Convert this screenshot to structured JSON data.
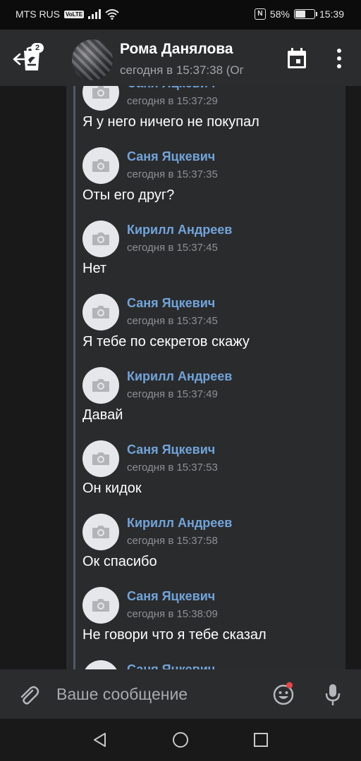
{
  "status_bar": {
    "carrier": "MTS RUS",
    "volte": "VoLTE",
    "nfc": "N",
    "battery_percent": "58%",
    "battery_level": 0.58,
    "time": "15:39"
  },
  "header": {
    "badge_count": "2",
    "title": "Рома Данялова",
    "subtitle": "сегодня в 15:37:38 (Ог"
  },
  "messages": [
    {
      "author": "Саня Яцкевич",
      "time": "сегодня в 15:37:29",
      "text": "Я у него ничего не покупал"
    },
    {
      "author": "Саня Яцкевич",
      "time": "сегодня в 15:37:35",
      "text": "Оты его друг?"
    },
    {
      "author": "Кирилл Андреев",
      "time": "сегодня в 15:37:45",
      "text": "Нет"
    },
    {
      "author": "Саня Яцкевич",
      "time": "сегодня в 15:37:45",
      "text": "Я тебе по секретов скажу"
    },
    {
      "author": "Кирилл Андреев",
      "time": "сегодня в 15:37:49",
      "text": "Давай"
    },
    {
      "author": "Саня Яцкевич",
      "time": "сегодня в 15:37:53",
      "text": "Он кидок"
    },
    {
      "author": "Кирилл Андреев",
      "time": "сегодня в 15:37:58",
      "text": "Ок спасибо"
    },
    {
      "author": "Саня Яцкевич",
      "time": "сегодня в 15:38:09",
      "text": "Не говори что я тебе сказал"
    },
    {
      "author": "Саня Яцкевич",
      "time": "",
      "text": ""
    }
  ],
  "composer": {
    "placeholder": "Ваше сообщение"
  },
  "colors": {
    "header_bg": "#2b2c2e",
    "chat_bg": "#19191a",
    "forwarded_bg": "#2a2b2d",
    "author_name": "#71a4d9",
    "timestamp": "#8f9094",
    "notification_dot": "#e64646"
  },
  "icons": {
    "back": "back-arrow-icon",
    "calendar": "calendar-icon",
    "more": "more-vertical-icon",
    "avatar_placeholder": "camera-icon",
    "attach": "paperclip-icon",
    "sticker": "smile-icon",
    "mic": "microphone-icon"
  }
}
